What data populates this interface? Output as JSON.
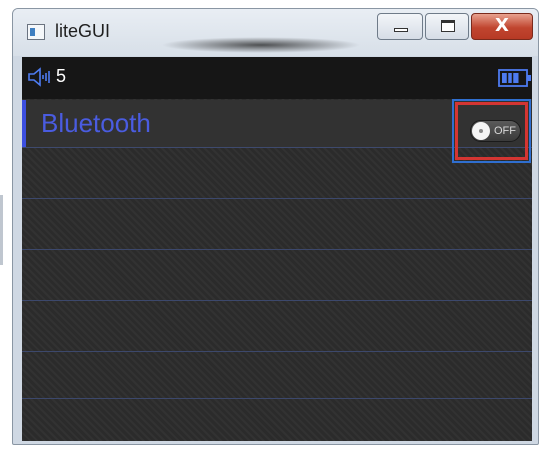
{
  "window": {
    "title": "liteGUI",
    "controls": {
      "minimize": "minimize",
      "maximize": "maximize",
      "close_glyph": "X"
    }
  },
  "status_bar": {
    "volume_icon": "speaker-icon",
    "volume_value": "5",
    "battery_icon": "battery-icon",
    "battery_level": 0.75
  },
  "settings": {
    "bluetooth": {
      "label": "Bluetooth",
      "toggle_state": "OFF",
      "is_on": false
    }
  },
  "colors": {
    "accent": "#4a5ce0",
    "highlight_outer": "#2f6fd0",
    "highlight_inner": "#d43532",
    "close_button": "#c0452f",
    "background": "#2b2b2b"
  }
}
